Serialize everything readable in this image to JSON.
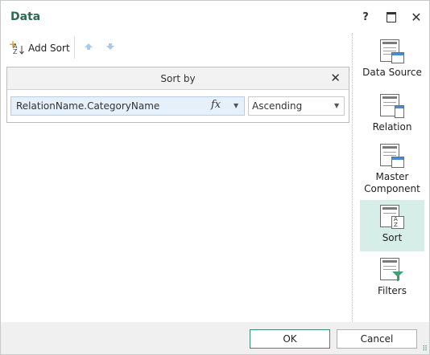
{
  "window": {
    "title": "Data"
  },
  "titlebar": {
    "help": "?",
    "close": "✕"
  },
  "toolbar": {
    "add_sort_label": "Add Sort"
  },
  "sort_panel": {
    "header": "Sort by",
    "close": "✕",
    "rows": [
      {
        "field": "RelationName.CategoryName",
        "fx": "fx",
        "order": "Ascending"
      }
    ]
  },
  "sidebar": {
    "items": [
      {
        "label": "Data Source",
        "icon": "data-source-icon"
      },
      {
        "label": "Relation",
        "icon": "relation-icon"
      },
      {
        "label": "Master\nComponent",
        "icon": "master-component-icon"
      },
      {
        "label": "Sort",
        "icon": "sort-icon",
        "active": true
      },
      {
        "label": "Filters",
        "icon": "filter-icon"
      }
    ]
  },
  "footer": {
    "ok": "OK",
    "cancel": "Cancel"
  },
  "colors": {
    "title": "#2b6a53",
    "active_bg": "#d6ede8",
    "arrow": "#4a8bd0",
    "filter": "#3aa372"
  }
}
